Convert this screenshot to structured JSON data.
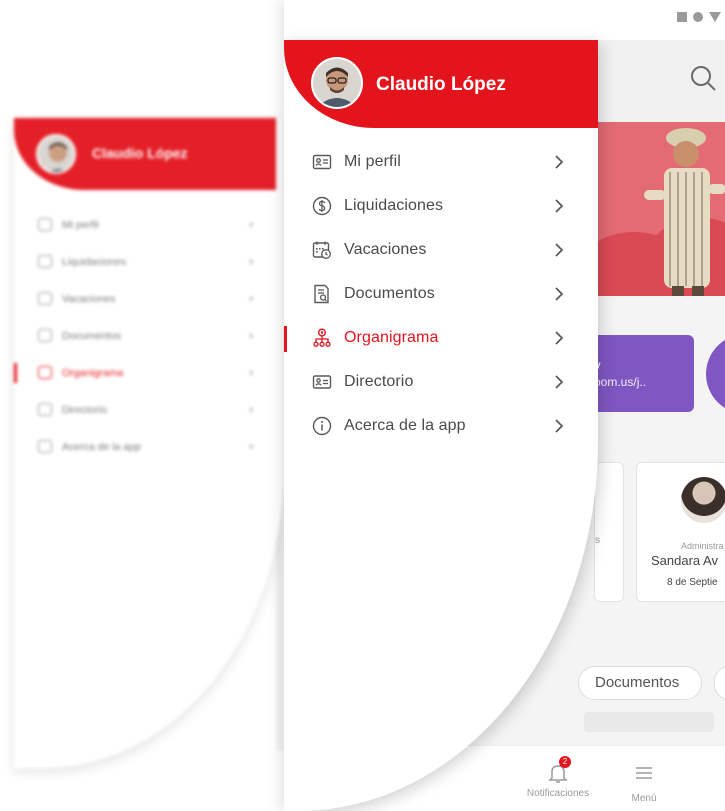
{
  "user": {
    "name": "Claudio López"
  },
  "menu": {
    "items": [
      {
        "label": "Mi perfil",
        "icon": "id-card-icon",
        "active": false
      },
      {
        "label": "Liquidaciones",
        "icon": "dollar-circle-icon",
        "active": false
      },
      {
        "label": "Vacaciones",
        "icon": "calendar-clock-icon",
        "active": false
      },
      {
        "label": "Documentos",
        "icon": "document-search-icon",
        "active": false
      },
      {
        "label": "Organigrama",
        "icon": "org-chart-icon",
        "active": true
      },
      {
        "label": "Directorio",
        "icon": "contact-card-icon",
        "active": false
      },
      {
        "label": "Acerca de la app",
        "icon": "info-circle-icon",
        "active": false
      }
    ]
  },
  "background": {
    "meeting": {
      "title": "dev",
      "link": "b.zoom.us/j.."
    },
    "card_partial": {
      "text": "s"
    },
    "birthday_card": {
      "role": "Administra",
      "name": "Sandara Av",
      "date": "8 de Septie"
    },
    "chip": {
      "label": "Documentos"
    },
    "nav": {
      "notifications_label": "Notificaciones",
      "notifications_badge": "2",
      "menu_label": "Menú"
    }
  },
  "colors": {
    "brand": "#e3141c",
    "purple": "#8057c2",
    "text": "#4a4a4a",
    "muted": "#9a9a9a"
  }
}
